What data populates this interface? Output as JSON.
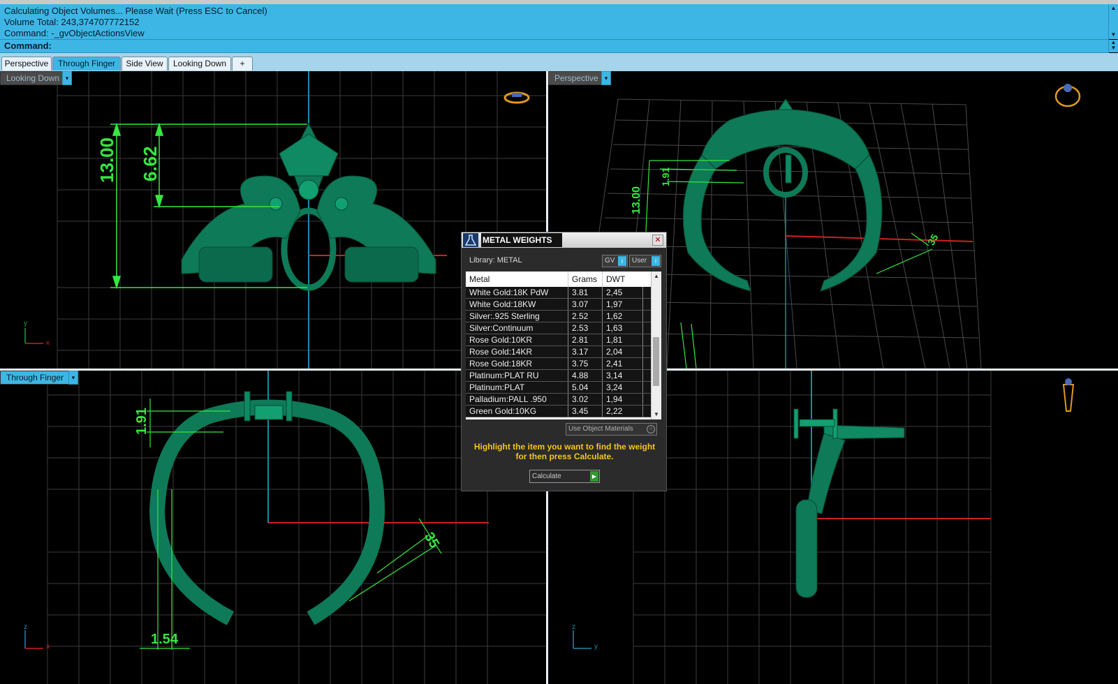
{
  "command_history": {
    "line1": "Calculating Object Volumes... Please Wait (Press ESC to Cancel)",
    "line2": "Volume Total: 243,374707772152",
    "line3": "Command: -_gvObjectActionsView"
  },
  "command_prompt": {
    "label": "Command:"
  },
  "tabs": [
    "Perspective",
    "Through Finger",
    "Side View",
    "Looking Down",
    "+"
  ],
  "active_tab": "Through Finger",
  "viewports": {
    "top_left": {
      "label": "Looking Down",
      "dims": [
        "13.00",
        "6.62"
      ]
    },
    "top_right": {
      "label": "Perspective",
      "dims": [
        "13.00",
        "1.91",
        "35"
      ]
    },
    "bottom_left": {
      "label": "Through Finger",
      "dims": [
        "1.91",
        "1.54",
        "35"
      ]
    },
    "bottom_right": {
      "label": ""
    }
  },
  "axes": {
    "x": "x",
    "y": "y",
    "z": "z"
  },
  "dialog": {
    "title": "METAL WEIGHTS",
    "library_label": "Library: METAL",
    "gv_label": "GV",
    "user_label": "User",
    "columns": [
      "Metal",
      "Grams",
      "DWT"
    ],
    "rows": [
      [
        "White Gold:18K PdW",
        "3.81",
        "2,45"
      ],
      [
        "White Gold:18KW",
        "3.07",
        "1,97"
      ],
      [
        "Silver:.925 Sterling",
        "2.52",
        "1,62"
      ],
      [
        "Silver:Continuum",
        "2.53",
        "1,63"
      ],
      [
        "Rose Gold:10KR",
        "2.81",
        "1,81"
      ],
      [
        "Rose Gold:14KR",
        "3.17",
        "2,04"
      ],
      [
        "Rose Gold:18KR",
        "3.75",
        "2,41"
      ],
      [
        "Platinum:PLAT RU",
        "4.88",
        "3,14"
      ],
      [
        "Platinum:PLAT",
        "5.04",
        "3,24"
      ],
      [
        "Palladium:PALL .950",
        "3.02",
        "1,94"
      ],
      [
        "Green Gold:10KG",
        "3.45",
        "2,22"
      ]
    ],
    "use_object_materials": "Use Object Materials",
    "hint": "Highlight the item you want to find the weight for then press Calculate.",
    "calculate_label": "Calculate"
  },
  "colors": {
    "accent": "#3db6e6",
    "model_green": "#0e7a58",
    "dimension_green": "#35e840",
    "grid": "#4a4a4a",
    "axis_red": "#d02020",
    "axis_blue": "#1a8aa8",
    "hint_yellow": "#f5c518"
  }
}
